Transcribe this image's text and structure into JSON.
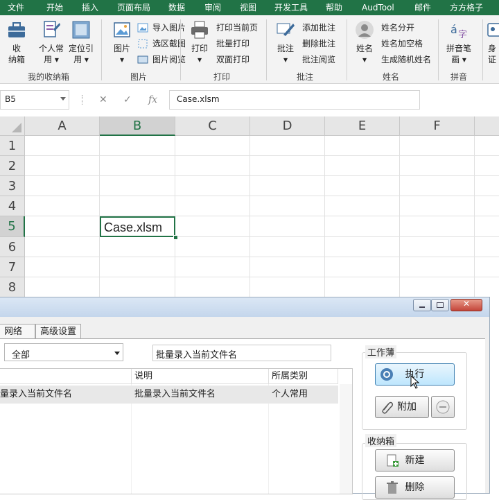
{
  "ribbon": {
    "tabs": [
      "文件",
      "开始",
      "插入",
      "页面布局",
      "数据",
      "审阅",
      "视图",
      "开发工具",
      "帮助",
      "AudTool",
      "邮件",
      "方方格子"
    ],
    "groups": {
      "storage": {
        "label": "我的收纳箱",
        "btn_collect_1": "收",
        "btn_collect_2": "纳箱",
        "btn_personal_1": "个人常",
        "btn_personal_2": "用",
        "btn_locate_1": "定位引",
        "btn_locate_2": "用"
      },
      "picture": {
        "label": "图片",
        "big_label": "图片",
        "items": [
          "导入图片",
          "选区截图",
          "图片阅览"
        ]
      },
      "print": {
        "label": "打印",
        "big_label": "打印",
        "items": [
          "打印当前页",
          "批量打印",
          "双面打印"
        ]
      },
      "comment": {
        "label": "批注",
        "big_label": "批注",
        "items": [
          "添加批注",
          "删除批注",
          "批注阅览"
        ]
      },
      "name": {
        "label": "姓名",
        "big_label": "姓名",
        "items": [
          "姓名分开",
          "姓名加空格",
          "生成随机姓名"
        ]
      },
      "pinyin": {
        "label": "拼音",
        "big_label_1": "拼音笔",
        "big_label_2": "画"
      },
      "id": {
        "big_label_1": "身",
        "big_label_2": "证"
      }
    }
  },
  "formula_bar": {
    "name_box": "B5",
    "cancel_symbol": "✕",
    "confirm_symbol": "✓",
    "fx_symbol": "fx",
    "content": "Case.xlsm"
  },
  "sheet": {
    "columns": [
      "A",
      "B",
      "C",
      "D",
      "E",
      "F"
    ],
    "rows": [
      "1",
      "2",
      "3",
      "4",
      "5",
      "6",
      "7",
      "8"
    ],
    "active_cell": "B5",
    "active_value": "Case.xlsm"
  },
  "dialog": {
    "tabs": [
      "网络",
      "高级设置"
    ],
    "category": "全部",
    "filter_text": "批量录入当前文件名",
    "list": {
      "headers": [
        "",
        "说明",
        "所属类别"
      ],
      "rows": [
        [
          "量录入当前文件名",
          "批量录入当前文件名",
          "个人常用"
        ]
      ]
    },
    "workbook_group": {
      "title": "工作薄",
      "execute": "执行",
      "attach": "附加"
    },
    "storage_group": {
      "title": "收纳箱",
      "new": "新建",
      "delete": "删除"
    }
  },
  "colors": {
    "excel_green": "#217346",
    "selection": "#217346"
  }
}
